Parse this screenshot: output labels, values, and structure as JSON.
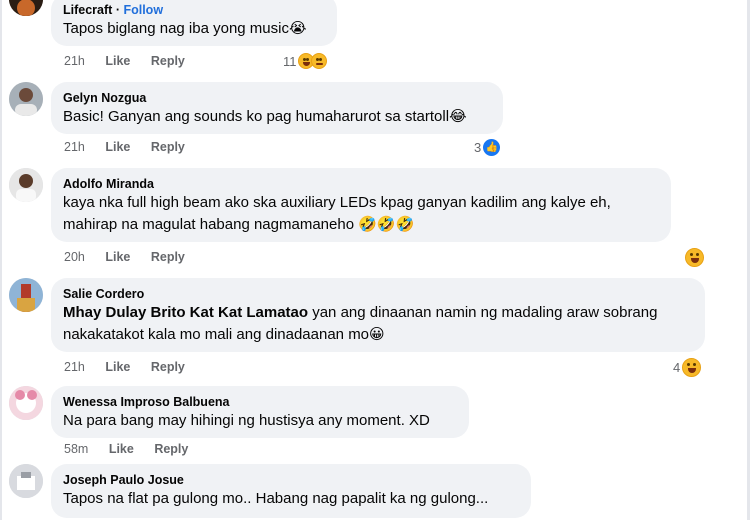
{
  "comments": [
    {
      "name": "Lifecraft",
      "follow": "Follow",
      "separator": "·",
      "text": "Tapos biglang nag iba yong music",
      "emoji": "😭",
      "time": "21h",
      "like": "Like",
      "reply": "Reply",
      "reactions": "11",
      "reaction_icons": [
        "laughing-crying-icon",
        "sad-tear-icon"
      ]
    },
    {
      "name": "Gelyn Nozgua",
      "text": "Basic! Ganyan ang sounds ko pag humaharurot sa startoll",
      "emoji": "😂",
      "time": "21h",
      "like": "Like",
      "reply": "Reply",
      "reactions": "3",
      "reaction_icons": [
        "like-icon"
      ]
    },
    {
      "name": "Adolfo Miranda",
      "text_line1": "kaya nka full high beam ako ska auxiliary LEDs kpag ganyan kadilim ang kalye eh,",
      "text_line2": "mahirap na magulat habang nagmamaneho",
      "emojis": "🤣🤣🤣",
      "time": "20h",
      "like": "Like",
      "reply": "Reply",
      "reaction_icons": [
        "laughing-icon"
      ]
    },
    {
      "name": "Salie Cordero",
      "tag": "Mhay Dulay Brito Kat Kat Lamatao",
      "text_line1": "yan ang dinaanan namin ng madaling araw sobrang",
      "text_line2": "nakakatakot kala mo mali ang dinadaanan mo",
      "emoji": "😀",
      "time": "21h",
      "like": "Like",
      "reply": "Reply",
      "reactions": "4",
      "reaction_icons": [
        "laughing-icon"
      ]
    },
    {
      "name": "Wenessa Improso Balbuena",
      "text": "Na para bang may hihingi ng hustisya any moment. XD",
      "time": "58m",
      "like": "Like",
      "reply": "Reply"
    },
    {
      "name": "Joseph Paulo Josue",
      "text": "Tapos na flat pa gulong mo.. Habang nag papalit ka ng gulong..."
    }
  ],
  "colors": {
    "bubble": "#f0f2f5",
    "meta_text": "#65676b",
    "follow_blue": "#216fdb",
    "like_blue": "#1877f2",
    "emoji_yellow": "#f7b928"
  }
}
